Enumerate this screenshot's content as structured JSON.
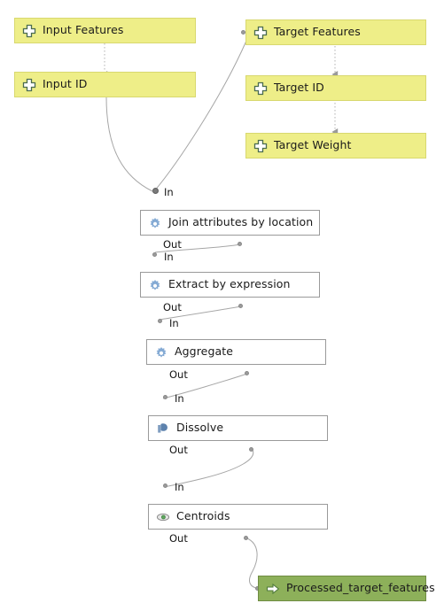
{
  "canvas": {
    "background": "#ffffff",
    "param_fill": "#eeee88",
    "param_border": "#d8d86f",
    "algo_fill": "#ffffff",
    "algo_border": "#9a9a9a",
    "output_fill": "#8db05a",
    "output_border": "#6f8c43",
    "link_color": "#999999",
    "port_dot_color": "#8a8a8a"
  },
  "parameters": [
    {
      "label": "Input Features",
      "icon": "parameter-plus-icon"
    },
    {
      "label": "Input ID",
      "icon": "parameter-plus-icon"
    },
    {
      "label": "Target Features",
      "icon": "parameter-plus-icon"
    },
    {
      "label": "Target ID",
      "icon": "parameter-plus-icon"
    },
    {
      "label": "Target Weight",
      "icon": "parameter-plus-icon"
    }
  ],
  "algorithms": [
    {
      "label": "Join attributes by location",
      "icon": "gear-icon",
      "in_label": "In",
      "out_label": "Out"
    },
    {
      "label": "Extract by expression",
      "icon": "gear-icon",
      "in_label": "In",
      "out_label": "Out"
    },
    {
      "label": "Aggregate",
      "icon": "gear-icon",
      "in_label": "In",
      "out_label": "Out"
    },
    {
      "label": "Dissolve",
      "icon": "dissolve-icon",
      "in_label": "In",
      "out_label": "Out"
    },
    {
      "label": "Centroids",
      "icon": "centroid-icon",
      "in_label": "In",
      "out_label": "Out"
    }
  ],
  "outputs": [
    {
      "label": "Processed_target_features",
      "icon": "output-arrow-icon"
    }
  ],
  "ports": {
    "in_label": "In",
    "out_label": "Out"
  }
}
